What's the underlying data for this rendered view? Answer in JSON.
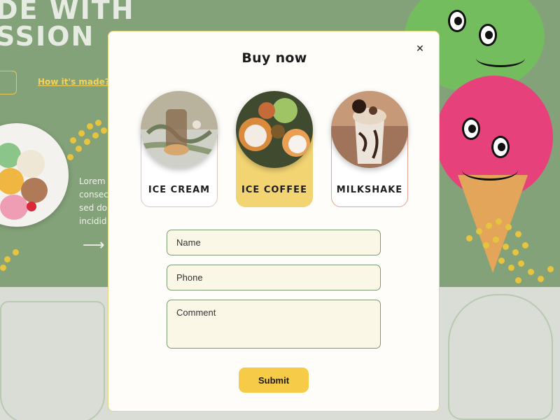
{
  "background": {
    "hero_line_1": "DE WITH",
    "hero_line_2": "SSION",
    "how_link": "How it's made?",
    "lorem_lines": [
      "Lorem",
      "consec",
      "sed do",
      "incidid"
    ]
  },
  "modal": {
    "title": "Buy now",
    "close_icon": "close-icon"
  },
  "products": [
    {
      "label": "ICE CREAM",
      "selected": false
    },
    {
      "label": "ICE COFFEE",
      "selected": true
    },
    {
      "label": "MILKSHAKE",
      "selected": false
    }
  ],
  "form": {
    "name_placeholder": "Name",
    "phone_placeholder": "Phone",
    "comment_placeholder": "Comment",
    "submit_label": "Submit"
  },
  "colors": {
    "accent_yellow": "#f5cb47",
    "background_green": "#84a279",
    "field_border": "#7e9a75"
  }
}
